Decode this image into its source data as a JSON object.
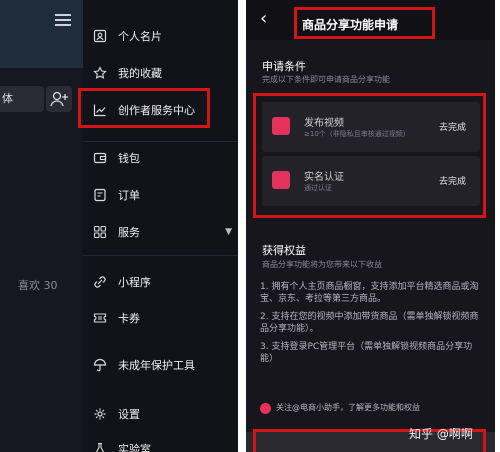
{
  "left_panel": {
    "search_fragment": "体",
    "likes_text": "喜欢 30",
    "menu_items": [
      {
        "label": "个人名片",
        "icon": "id-card-icon"
      },
      {
        "label": "我的收藏",
        "icon": "star-icon"
      },
      {
        "label": "创作者服务中心",
        "icon": "chart-line-icon"
      },
      {
        "label": "钱包",
        "icon": "wallet-icon"
      },
      {
        "label": "订单",
        "icon": "order-icon"
      },
      {
        "label": "服务",
        "icon": "grid-icon"
      },
      {
        "label": "小程序",
        "icon": "miniprogram-icon"
      },
      {
        "label": "卡券",
        "icon": "coupon-icon"
      },
      {
        "label": "未成年保护工具",
        "icon": "umbrella-icon"
      },
      {
        "label": "设置",
        "icon": "gear-icon"
      },
      {
        "label": "实验室",
        "icon": "lab-icon"
      }
    ]
  },
  "right_panel": {
    "title": "商品分享功能申请",
    "conditions": {
      "heading": "申请条件",
      "subheading": "完成以下条件即可申请商品分享功能",
      "items": [
        {
          "title": "发布视频",
          "subtitle": "≥10个（非隐私且审核通过视频）",
          "action": "去完成"
        },
        {
          "title": "实名认证",
          "subtitle": "通过认证",
          "action": "去完成"
        }
      ]
    },
    "benefits": {
      "heading": "获得权益",
      "subheading": "商品分享功能将为您带来以下收益",
      "items": [
        "1. 拥有个人主页商品橱窗，支持添加平台精选商品或淘宝、京东、考拉等第三方商品。",
        "2. 支持在您的视频中添加带货商品（需单独解锁视频商品分享功能）。",
        "3. 支持登录PC管理平台（需单独解锁视频商品分享功能）"
      ]
    },
    "follow_text": "关注@电商小助手，了解更多功能和权益"
  },
  "watermark": "知乎 @啊啊",
  "colors": {
    "highlight_red": "#d01616",
    "accent_pink": "#e4325a"
  }
}
